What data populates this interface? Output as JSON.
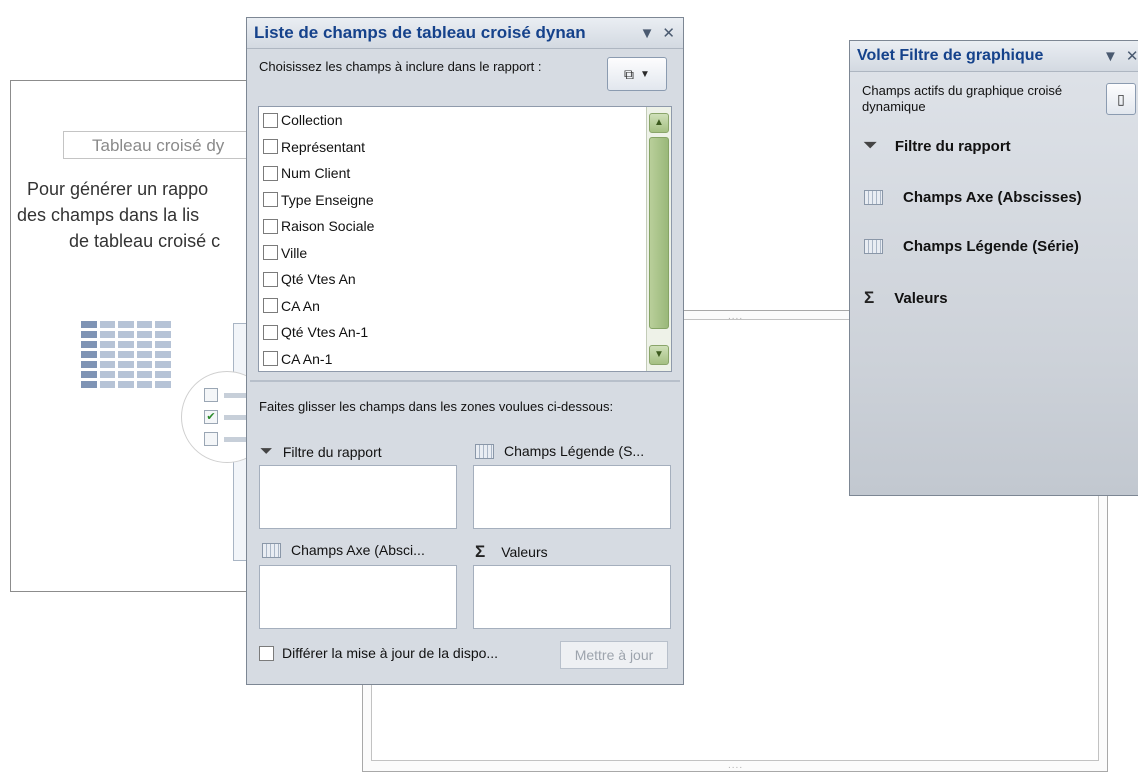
{
  "pivot_placeholder": {
    "title": "Tableau croisé dy",
    "lines": [
      "Pour générer un rappo",
      "des champs dans la lis",
      "de tableau croisé c"
    ]
  },
  "field_list": {
    "title": "Liste de champs de tableau croisé dynan",
    "choose_label": "Choisissez les champs à inclure dans le rapport :",
    "fields": [
      "Collection",
      "Représentant",
      "Num Client",
      "Type Enseigne",
      "Raison Sociale",
      "Ville",
      "Qté Vtes An",
      "CA An",
      "Qté Vtes An-1",
      "CA An-1"
    ],
    "drag_label": "Faites glisser les champs dans les zones voulues ci-dessous:",
    "areas": {
      "report_filter": "Filtre du rapport",
      "legend_fields": "Champs Légende (S...",
      "axis_fields": "Champs Axe (Absci...",
      "values": "Valeurs"
    },
    "defer_label": "Différer la mise à jour de la dispo...",
    "update_button": "Mettre à jour"
  },
  "chart_filter": {
    "title": "Volet Filtre de graphique",
    "active_fields": "Champs actifs du graphique croisé dynamique",
    "items": {
      "report_filter": "Filtre du rapport",
      "axis_fields": "Champs Axe (Abscisses)",
      "legend_fields": "Champs Légende (Série)",
      "values": "Valeurs"
    }
  },
  "icons": {
    "filter": "filter-icon",
    "grid": "grid-icon",
    "sigma": "sigma-icon",
    "dropdown": "dropdown-arrow-icon",
    "close": "close-icon",
    "layout": "layout-icon"
  }
}
